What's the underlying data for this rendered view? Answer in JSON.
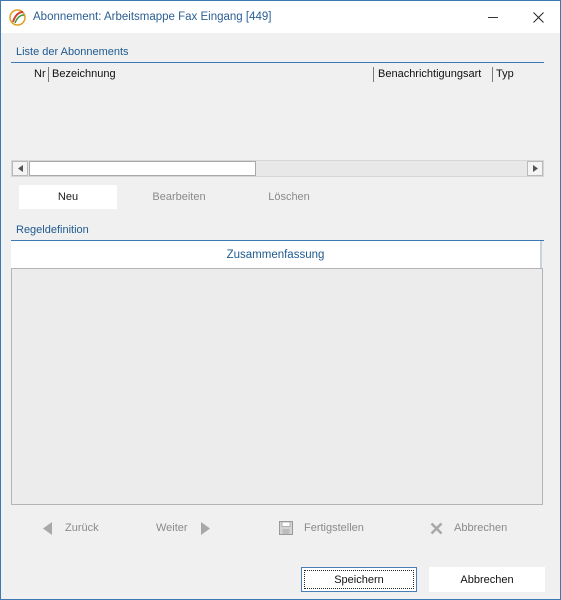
{
  "window": {
    "title": "Abonnement: Arbeitsmappe Fax Eingang [449]",
    "minimize_glyph": "",
    "close_glyph": "✕"
  },
  "subscriptions": {
    "section_label": "Liste der Abonnements",
    "columns": [
      "Nr",
      "Bezeichnung",
      "Benachrichtigungsart",
      "Typ"
    ],
    "rows": []
  },
  "list_actions": {
    "new_label": "Neu",
    "edit_label": "Bearbeiten",
    "delete_label": "Löschen"
  },
  "rule_definition": {
    "section_label": "Regeldefinition",
    "summary_header": "Zusammenfassung"
  },
  "wizard": {
    "back_label": "Zurück",
    "next_label": "Weiter",
    "finish_label": "Fertigstellen",
    "abort_label": "Abbrechen"
  },
  "dialog": {
    "save_label": "Speichern",
    "cancel_label": "Abbrechen"
  },
  "colors": {
    "accent": "#1f5a8f",
    "border": "#3c78b4",
    "disabled": "#8a8a8a"
  }
}
